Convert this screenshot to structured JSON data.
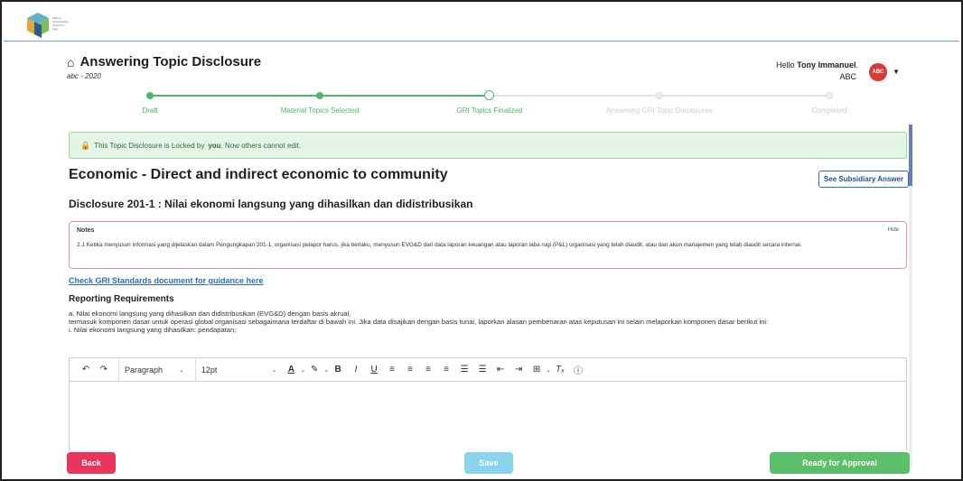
{
  "app": {
    "logo_text": "Making Sustainability Reporting Easy"
  },
  "header": {
    "title": "Answering Topic Disclosure",
    "subtitle": "abc - 2020",
    "greeting_prefix": "Hello",
    "user_name": "Tony Immanuel",
    "company": "ABC",
    "avatar_text": "ABC"
  },
  "stepper": {
    "steps": [
      {
        "label": "Draft",
        "state": "done"
      },
      {
        "label": "Material Topics Selected",
        "state": "done"
      },
      {
        "label": "GRI Topics Finalized",
        "state": "current"
      },
      {
        "label": "Answering GRI Topic Disclosures",
        "state": "todo"
      },
      {
        "label": "Completed",
        "state": "todo"
      }
    ]
  },
  "lock_banner": {
    "text_before": "This Topic Disclosure is Locked by",
    "who": "you",
    "text_after": ". Now others cannot edit."
  },
  "section": {
    "title": "Economic - Direct and indirect economic to community",
    "subsidiary_button": "See Subsidiary Answer",
    "disclosure_title": "Disclosure 201-1 : Nilai ekonomi langsung yang dihasilkan dan didistribusikan"
  },
  "notes": {
    "label": "Notes",
    "hide": "Hide",
    "text": "2.1 Ketika menyusun informasi yang dijelaskan dalam Pengungkapan 201-1, organisasi pelapor harus, jika berlaku, menyusun EVG&D dari data laporan keuangan atau laporan laba rugi (P&L) organisasi yang telah diaudit, atau dari akun manajemen yang telah diaudit secara internal."
  },
  "guidance_link": "Check GRI Standards document for guidance here",
  "requirements": {
    "title": "Reporting Requirements",
    "lines": [
      "a. Nilai ekonomi langsung yang dihasilkan dan didistribusikan (EVG&D) dengan basis akrual,",
      "termasuk komponen dasar untuk operasi global organisasi sebagaimana terdaftar di bawah ini. Jika data disajikan dengan basis tunai, laporkan alasan pembenaran atas keputusan ini selain melaporkan komponen dasar berikut ini:",
      "i. Nilai ekonomi langsung yang dihasilkan: pendapatan;"
    ]
  },
  "editor": {
    "block_format": "Paragraph",
    "font_size": "12pt",
    "value": ""
  },
  "footer": {
    "back": "Back",
    "save": "Save",
    "ready": "Ready for Approval"
  },
  "colors": {
    "accent_green": "#4eb86a",
    "back_red": "#e9355c",
    "save_blue": "#8ad3ee",
    "link_blue": "#2b6ec0"
  }
}
